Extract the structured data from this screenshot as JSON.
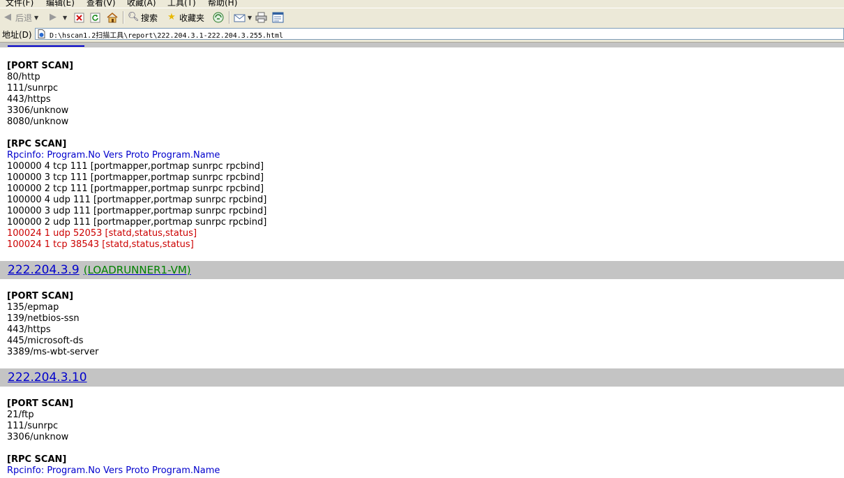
{
  "menu": [
    "文件(F)",
    "编辑(E)",
    "查看(V)",
    "收藏(A)",
    "工具(T)",
    "帮助(H)"
  ],
  "toolbar": {
    "back": "后退",
    "search": "搜索",
    "favorites": "收藏夹"
  },
  "address": {
    "label": "地址(D)",
    "url": "D:\\hscan1.2扫描工具\\report\\222.204.3.1-222.204.3.255.html"
  },
  "report": {
    "section1": {
      "port_header": "[PORT SCAN]",
      "ports": [
        "80/http",
        "111/sunrpc",
        "443/https",
        "3306/unknow",
        "8080/unknow"
      ],
      "rpc_header": "[RPC SCAN]",
      "rpc_info": "Rpcinfo: Program.No Vers Proto Program.Name",
      "rpc": [
        "100000 4 tcp 111 [portmapper,portmap sunrpc rpcbind]",
        "100000 3 tcp 111 [portmapper,portmap sunrpc rpcbind]",
        "100000 2 tcp 111 [portmapper,portmap sunrpc rpcbind]",
        "100000 4 udp 111 [portmapper,portmap sunrpc rpcbind]",
        "100000 3 udp 111 [portmapper,portmap sunrpc rpcbind]",
        "100000 2 udp 111 [portmapper,portmap sunrpc rpcbind]"
      ],
      "rpc_red": [
        "100024 1 udp 52053 [statd,status,status]",
        "100024 1 tcp 38543 [statd,status,status]"
      ]
    },
    "host2": {
      "ip": "222.204.3.9",
      "hostname": "(LOADRUNNER1-VM)",
      "port_header": "[PORT SCAN]",
      "ports": [
        "135/epmap",
        "139/netbios-ssn",
        "443/https",
        "445/microsoft-ds",
        "3389/ms-wbt-server"
      ]
    },
    "host3": {
      "ip": "222.204.3.10",
      "port_header": "[PORT SCAN]",
      "ports": [
        "21/ftp",
        "111/sunrpc",
        "3306/unknow"
      ],
      "rpc_header": "[RPC SCAN]",
      "rpc_info": "Rpcinfo: Program.No Vers Proto Program.Name"
    }
  },
  "colors": {
    "link": "#0000cc",
    "hostname": "#008000",
    "alert": "#cc0000",
    "hostbar": "#c4c4c4"
  }
}
